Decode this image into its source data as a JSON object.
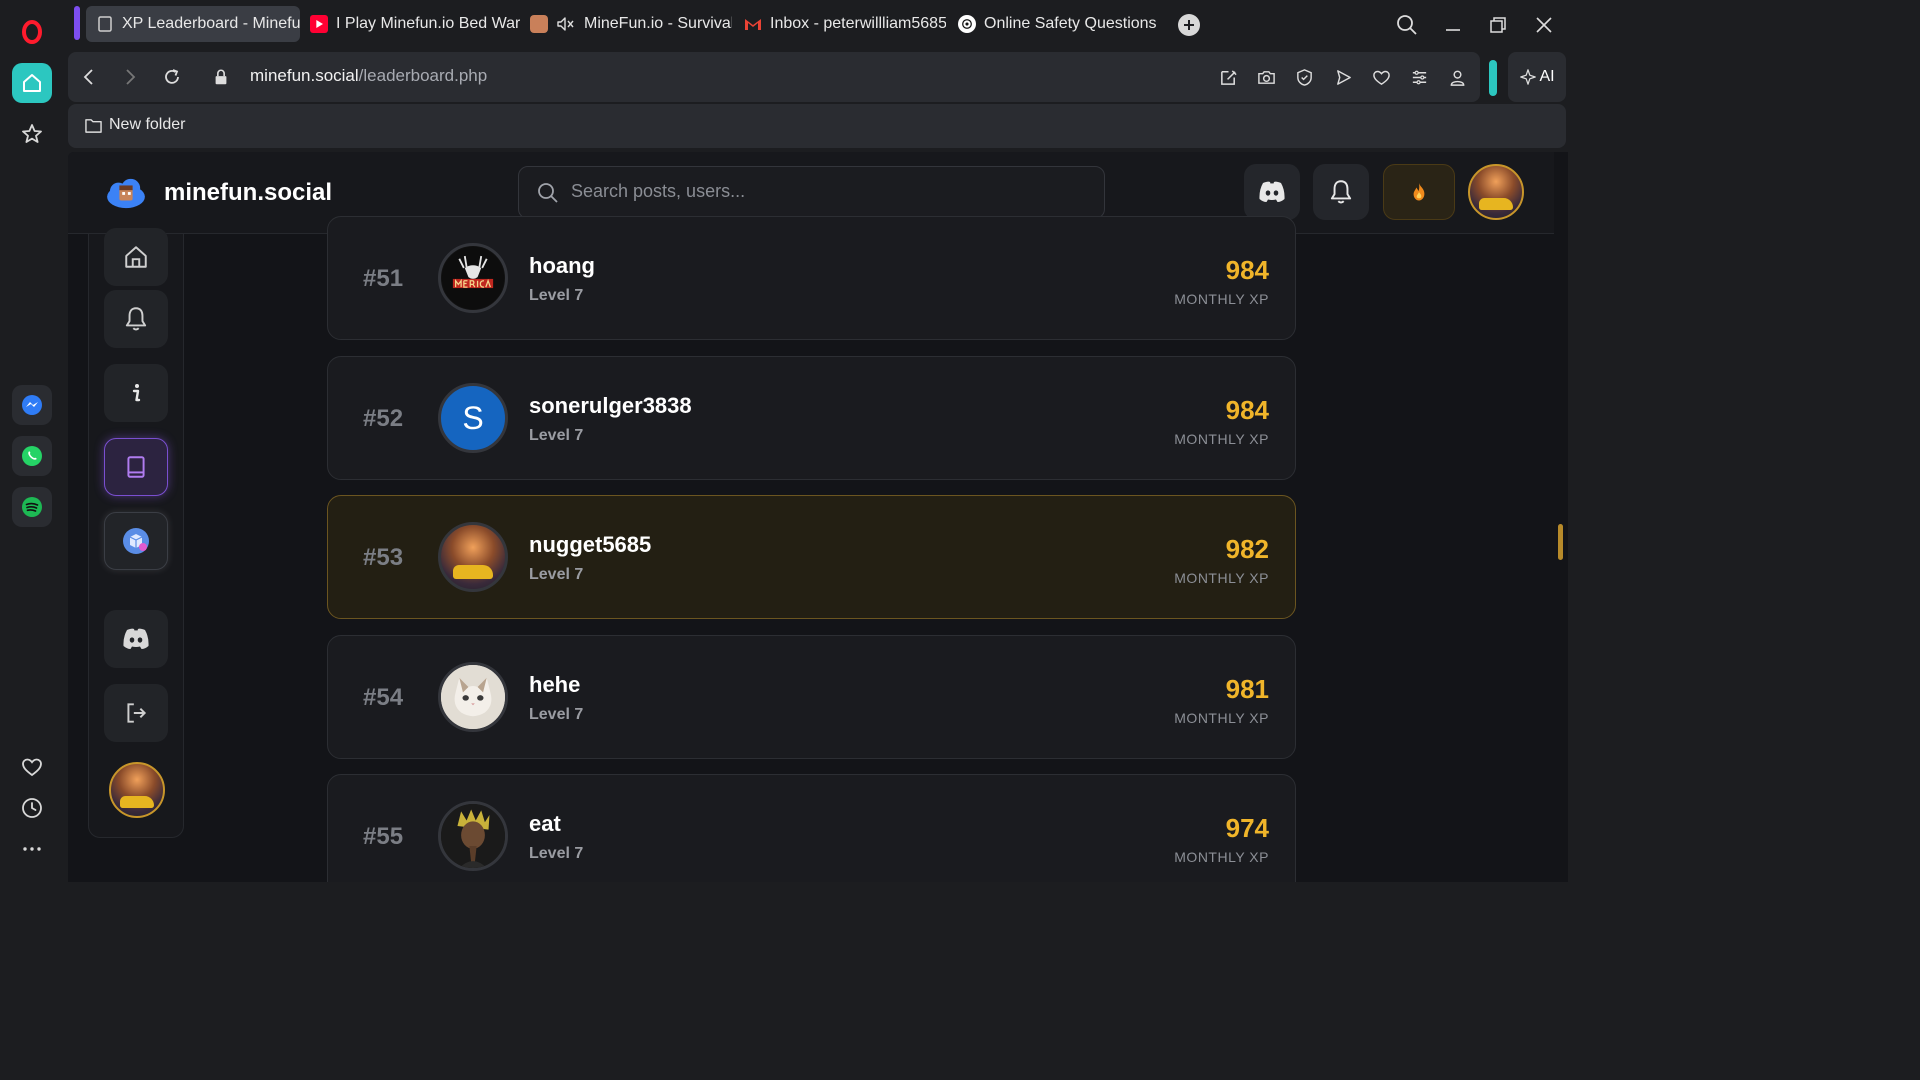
{
  "browser": {
    "tabs": [
      {
        "title": "XP Leaderboard - Minefun",
        "icon": "page-icon",
        "active": true
      },
      {
        "title": "I Play Minefun.io Bed Wars",
        "icon": "youtube-icon",
        "active": false
      },
      {
        "title": "MineFun.io - Survival",
        "icon": "minefun-icon",
        "muted": true,
        "active": false
      },
      {
        "title": "Inbox - peterwillliam5685",
        "icon": "gmail-icon",
        "active": false
      },
      {
        "title": "Online Safety Questions",
        "icon": "chatgpt-icon",
        "active": false
      }
    ],
    "url": {
      "host": "minefun.social",
      "path": "/leaderboard.php"
    },
    "ai_label": "AI",
    "bookmarks": [
      {
        "label": "New folder"
      }
    ]
  },
  "site": {
    "brand": "minefun.social",
    "search_placeholder": "Search posts, users..."
  },
  "leaderboard": {
    "rows": [
      {
        "rank": "#51",
        "name": "hoang",
        "level": "Level 7",
        "xp": "984",
        "xp_label": "MONTHLY XP",
        "avatar": "merica-logo"
      },
      {
        "rank": "#52",
        "name": "sonerulger3838",
        "level": "Level 7",
        "xp": "984",
        "xp_label": "MONTHLY XP",
        "avatar": "letter",
        "avatar_letter": "S"
      },
      {
        "rank": "#53",
        "name": "nugget5685",
        "level": "Level 7",
        "xp": "982",
        "xp_label": "MONTHLY XP",
        "avatar": "sunset-car",
        "current_user": true
      },
      {
        "rank": "#54",
        "name": "hehe",
        "level": "Level 7",
        "xp": "981",
        "xp_label": "MONTHLY XP",
        "avatar": "cat"
      },
      {
        "rank": "#55",
        "name": "eat",
        "level": "Level 7",
        "xp": "974",
        "xp_label": "MONTHLY XP",
        "avatar": "portrait"
      }
    ]
  },
  "colors": {
    "accent_xp": "#f0b52a",
    "current_user_border": "#6b5520",
    "active_nav": "#7a4fd0",
    "opera_red": "#ff1b2d",
    "teal": "#2cc7c0"
  }
}
